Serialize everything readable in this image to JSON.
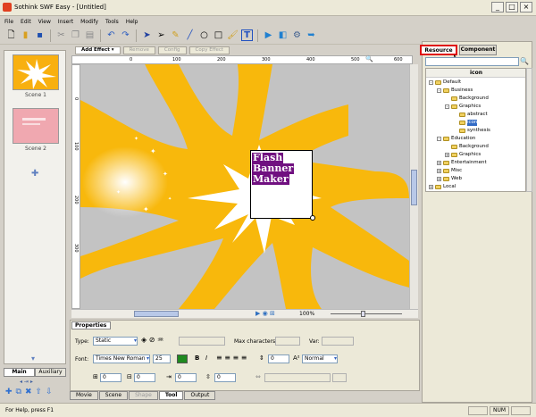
{
  "window": {
    "title": "Sothink SWF Easy - [Untitled]"
  },
  "menu": [
    "File",
    "Edit",
    "View",
    "Insert",
    "Modify",
    "Tools",
    "Help"
  ],
  "toolbar_icons": [
    "new-icon",
    "open-icon",
    "save-icon",
    "cut-icon",
    "copy-icon",
    "paste-icon",
    "undo-icon",
    "redo-icon",
    "select-icon",
    "subselect-icon",
    "pencil-icon",
    "line-icon",
    "ellipse-icon",
    "rectangle-icon",
    "brush-icon",
    "text-icon",
    "play-icon",
    "movie-icon",
    "publish-icon",
    "export-icon"
  ],
  "effect_toolbar": {
    "add_effect": "Add Effect ▾",
    "remove": "Remove",
    "config": "Config",
    "copy_effect": "Copy Effect"
  },
  "scenes": [
    {
      "label": "Scene 1"
    },
    {
      "label": "Scene 2"
    }
  ],
  "left_tabs": {
    "main": "Main",
    "auxiliary": "Auxiliary"
  },
  "canvas": {
    "text_lines": [
      "Flash",
      "Banner",
      "Maker"
    ],
    "zoom": "100%",
    "bg_color": "#c3c3c3",
    "burst_color": "#f8b80c"
  },
  "ruler_h_labels": [
    "0",
    "100",
    "200",
    "300",
    "400",
    "500",
    "600"
  ],
  "ruler_v_labels": [
    "0",
    "100",
    "200",
    "300"
  ],
  "properties": {
    "tab_label": "Properties",
    "type_label": "Type:",
    "type_value": "Static",
    "max_chars_label": "Max characters:",
    "var_label": "Var:",
    "font_label": "Font:",
    "font_value": "Times New Roman",
    "font_size": "25",
    "bold": "B",
    "italic": "I",
    "align_mode": "Normal",
    "spacing_fields": [
      "0",
      "0",
      "0",
      "0"
    ]
  },
  "bottom_tabs": [
    "Movie",
    "Scene",
    "Shape",
    "Tool",
    "Output"
  ],
  "bottom_active": "Tool",
  "right_panel": {
    "tabs": [
      "Resource",
      "Component"
    ],
    "active_tab": "Resource",
    "tree_header": "icon",
    "tree": [
      {
        "label": "Default",
        "depth": 0,
        "exp": "-"
      },
      {
        "label": "Business",
        "depth": 1,
        "exp": "-"
      },
      {
        "label": "Background",
        "depth": 2,
        "exp": ""
      },
      {
        "label": "Graphics",
        "depth": 2,
        "exp": "-"
      },
      {
        "label": "abstract",
        "depth": 3,
        "exp": ""
      },
      {
        "label": "icon",
        "depth": 3,
        "exp": "",
        "selected": true
      },
      {
        "label": "synthesis",
        "depth": 3,
        "exp": ""
      },
      {
        "label": "Education",
        "depth": 1,
        "exp": "-"
      },
      {
        "label": "Background",
        "depth": 2,
        "exp": ""
      },
      {
        "label": "Graphics",
        "depth": 2,
        "exp": "+"
      },
      {
        "label": "Entertainment",
        "depth": 1,
        "exp": "+"
      },
      {
        "label": "Misc",
        "depth": 1,
        "exp": "+"
      },
      {
        "label": "Web",
        "depth": 1,
        "exp": "+"
      },
      {
        "label": "Local",
        "depth": 0,
        "exp": "+"
      }
    ]
  },
  "status": {
    "text": "For Help, press F1",
    "num": "NUM"
  }
}
